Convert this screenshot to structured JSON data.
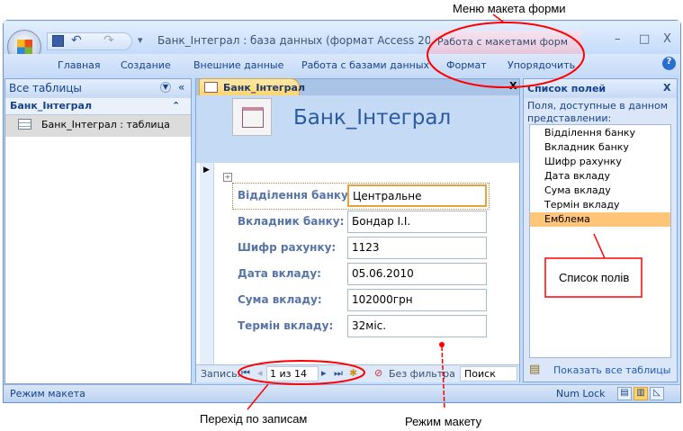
{
  "annotations": {
    "menu": "Меню макета форми",
    "fields": "Список полів",
    "nav": "Перехід по записам",
    "mode": "Режим макету"
  },
  "window": {
    "title": "Банк_Інтеграл : база данных (формат Access 20...",
    "context_tab_group": "Работа с макетами форм",
    "min": "–",
    "max": "□",
    "close": "X",
    "help": "?"
  },
  "ribbon": {
    "tabs": [
      "Главная",
      "Создание",
      "Внешние данные",
      "Работа с базами данных",
      "Формат",
      "Упорядочить"
    ]
  },
  "nav_pane": {
    "title": "Все таблицы",
    "collapse": "«",
    "group": "Банк_Інтеграл",
    "group_toggle": "⌃",
    "items": [
      "Банк_Інтеграл : таблица"
    ]
  },
  "document": {
    "tab": "Банк_Інтеграл",
    "close": "X",
    "form_title": "Банк_Інтеграл",
    "fields": [
      {
        "label": "Відділення банку:",
        "value": "Центральне"
      },
      {
        "label": "Вкладник банку:",
        "value": "Бондар І.І."
      },
      {
        "label": "Шифр рахунку:",
        "value": "1123"
      },
      {
        "label": "Дата вкладу:",
        "value": "05.06.2010"
      },
      {
        "label": "Сума вкладу:",
        "value": "102000грн"
      },
      {
        "label": "Термін вкладу:",
        "value": "32міс."
      }
    ]
  },
  "record_nav": {
    "label": "Запись:",
    "position": "1 из 14",
    "filter": "Без фильтра",
    "search": "Поиск"
  },
  "field_list": {
    "title": "Список полей",
    "close": "X",
    "description": "Поля, доступные в данном представлении:",
    "items": [
      "Відділення банку",
      "Вкладник банку",
      "Шифр рахунку",
      "Дата вкладу",
      "Сума вкладу",
      "Термін вкладу",
      "Емблема"
    ],
    "selected": "Емблема",
    "show_all": "Показать все таблицы"
  },
  "status": {
    "mode": "Режим макета",
    "numlock": "Num Lock"
  },
  "colors": {
    "annotation": "#ff0000",
    "selected": "#ffc67a"
  }
}
